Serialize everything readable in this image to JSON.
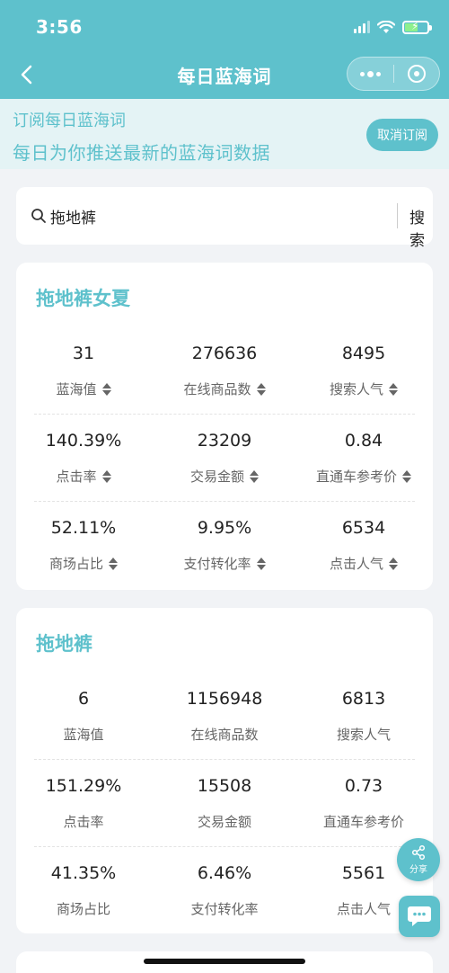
{
  "status_bar": {
    "time": "3:56"
  },
  "nav": {
    "title": "每日蓝海词",
    "back_icon": "chevron-left-icon",
    "more_icon": "more-dots-icon",
    "close_icon": "target-circle-icon"
  },
  "banner": {
    "line1": "订阅每日蓝海词",
    "line2": "每日为你推送最新的蓝海词数据",
    "unsubscribe_label": "取消订阅"
  },
  "search": {
    "value": "拖地裤",
    "button_label": "搜索",
    "icon": "search-icon"
  },
  "cards": [
    {
      "title": "拖地裤女夏",
      "sortable": true,
      "rows": [
        [
          {
            "value": "31",
            "label": "蓝海值"
          },
          {
            "value": "276636",
            "label": "在线商品数"
          },
          {
            "value": "8495",
            "label": "搜索人气"
          }
        ],
        [
          {
            "value": "140.39%",
            "label": "点击率"
          },
          {
            "value": "23209",
            "label": "交易金额"
          },
          {
            "value": "0.84",
            "label": "直通车参考价"
          }
        ],
        [
          {
            "value": "52.11%",
            "label": "商场占比"
          },
          {
            "value": "9.95%",
            "label": "支付转化率"
          },
          {
            "value": "6534",
            "label": "点击人气"
          }
        ]
      ]
    },
    {
      "title": "拖地裤",
      "sortable": false,
      "rows": [
        [
          {
            "value": "6",
            "label": "蓝海值"
          },
          {
            "value": "1156948",
            "label": "在线商品数"
          },
          {
            "value": "6813",
            "label": "搜索人气"
          }
        ],
        [
          {
            "value": "151.29%",
            "label": "点击率"
          },
          {
            "value": "15508",
            "label": "交易金额"
          },
          {
            "value": "0.73",
            "label": "直通车参考价"
          }
        ],
        [
          {
            "value": "41.35%",
            "label": "商场占比"
          },
          {
            "value": "6.46%",
            "label": "支付转化率"
          },
          {
            "value": "5561",
            "label": "点击人气"
          }
        ]
      ]
    }
  ],
  "fab": {
    "share_label": "分享",
    "share_icon": "share-icon",
    "chat_icon": "chat-bubble-icon"
  },
  "colors": {
    "accent": "#5ec1cc",
    "banner_bg": "#e4f3f5",
    "page_bg": "#f1f3f6"
  }
}
